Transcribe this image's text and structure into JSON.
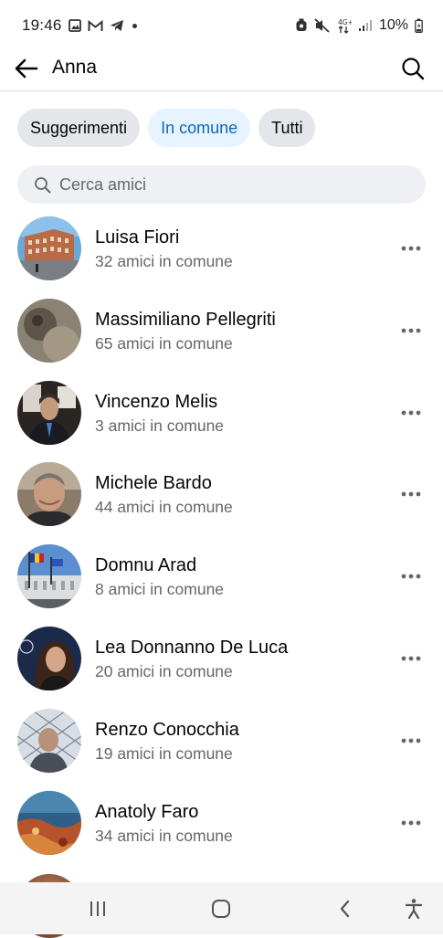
{
  "status_bar": {
    "time": "19:46",
    "battery": "10%",
    "network": "4G+"
  },
  "header": {
    "title": "Anna"
  },
  "chips": [
    {
      "label": "Suggerimenti",
      "active": false
    },
    {
      "label": "In comune",
      "active": true
    },
    {
      "label": "Tutti",
      "active": false
    }
  ],
  "search": {
    "placeholder": "Cerca amici"
  },
  "friends": [
    {
      "name": "Luisa Fiori",
      "mutual": "32 amici in comune"
    },
    {
      "name": "Massimiliano Pellegriti",
      "mutual": "65 amici in comune"
    },
    {
      "name": "Vincenzo Melis",
      "mutual": "3 amici in comune"
    },
    {
      "name": "Michele Bardo",
      "mutual": "44 amici in comune"
    },
    {
      "name": "Domnu Arad",
      "mutual": "8 amici in comune"
    },
    {
      "name": "Lea Donnanno De Luca",
      "mutual": "20 amici in comune"
    },
    {
      "name": "Renzo Conocchia",
      "mutual": "19 amici in comune"
    },
    {
      "name": "Anatoly Faro",
      "mutual": "34 amici in comune"
    }
  ],
  "colors": {
    "accent": "#0a66c2",
    "chip_active_bg": "#e7f3ff",
    "chip_bg": "#e4e6eb",
    "secondary_text": "#65676b"
  },
  "icons": {
    "back": "arrow-left-icon",
    "search": "search-icon",
    "more": "more-horizontal-icon",
    "nav_recents": "recents-icon",
    "nav_home": "home-icon",
    "nav_back": "nav-back-icon",
    "nav_accessibility": "accessibility-icon"
  }
}
